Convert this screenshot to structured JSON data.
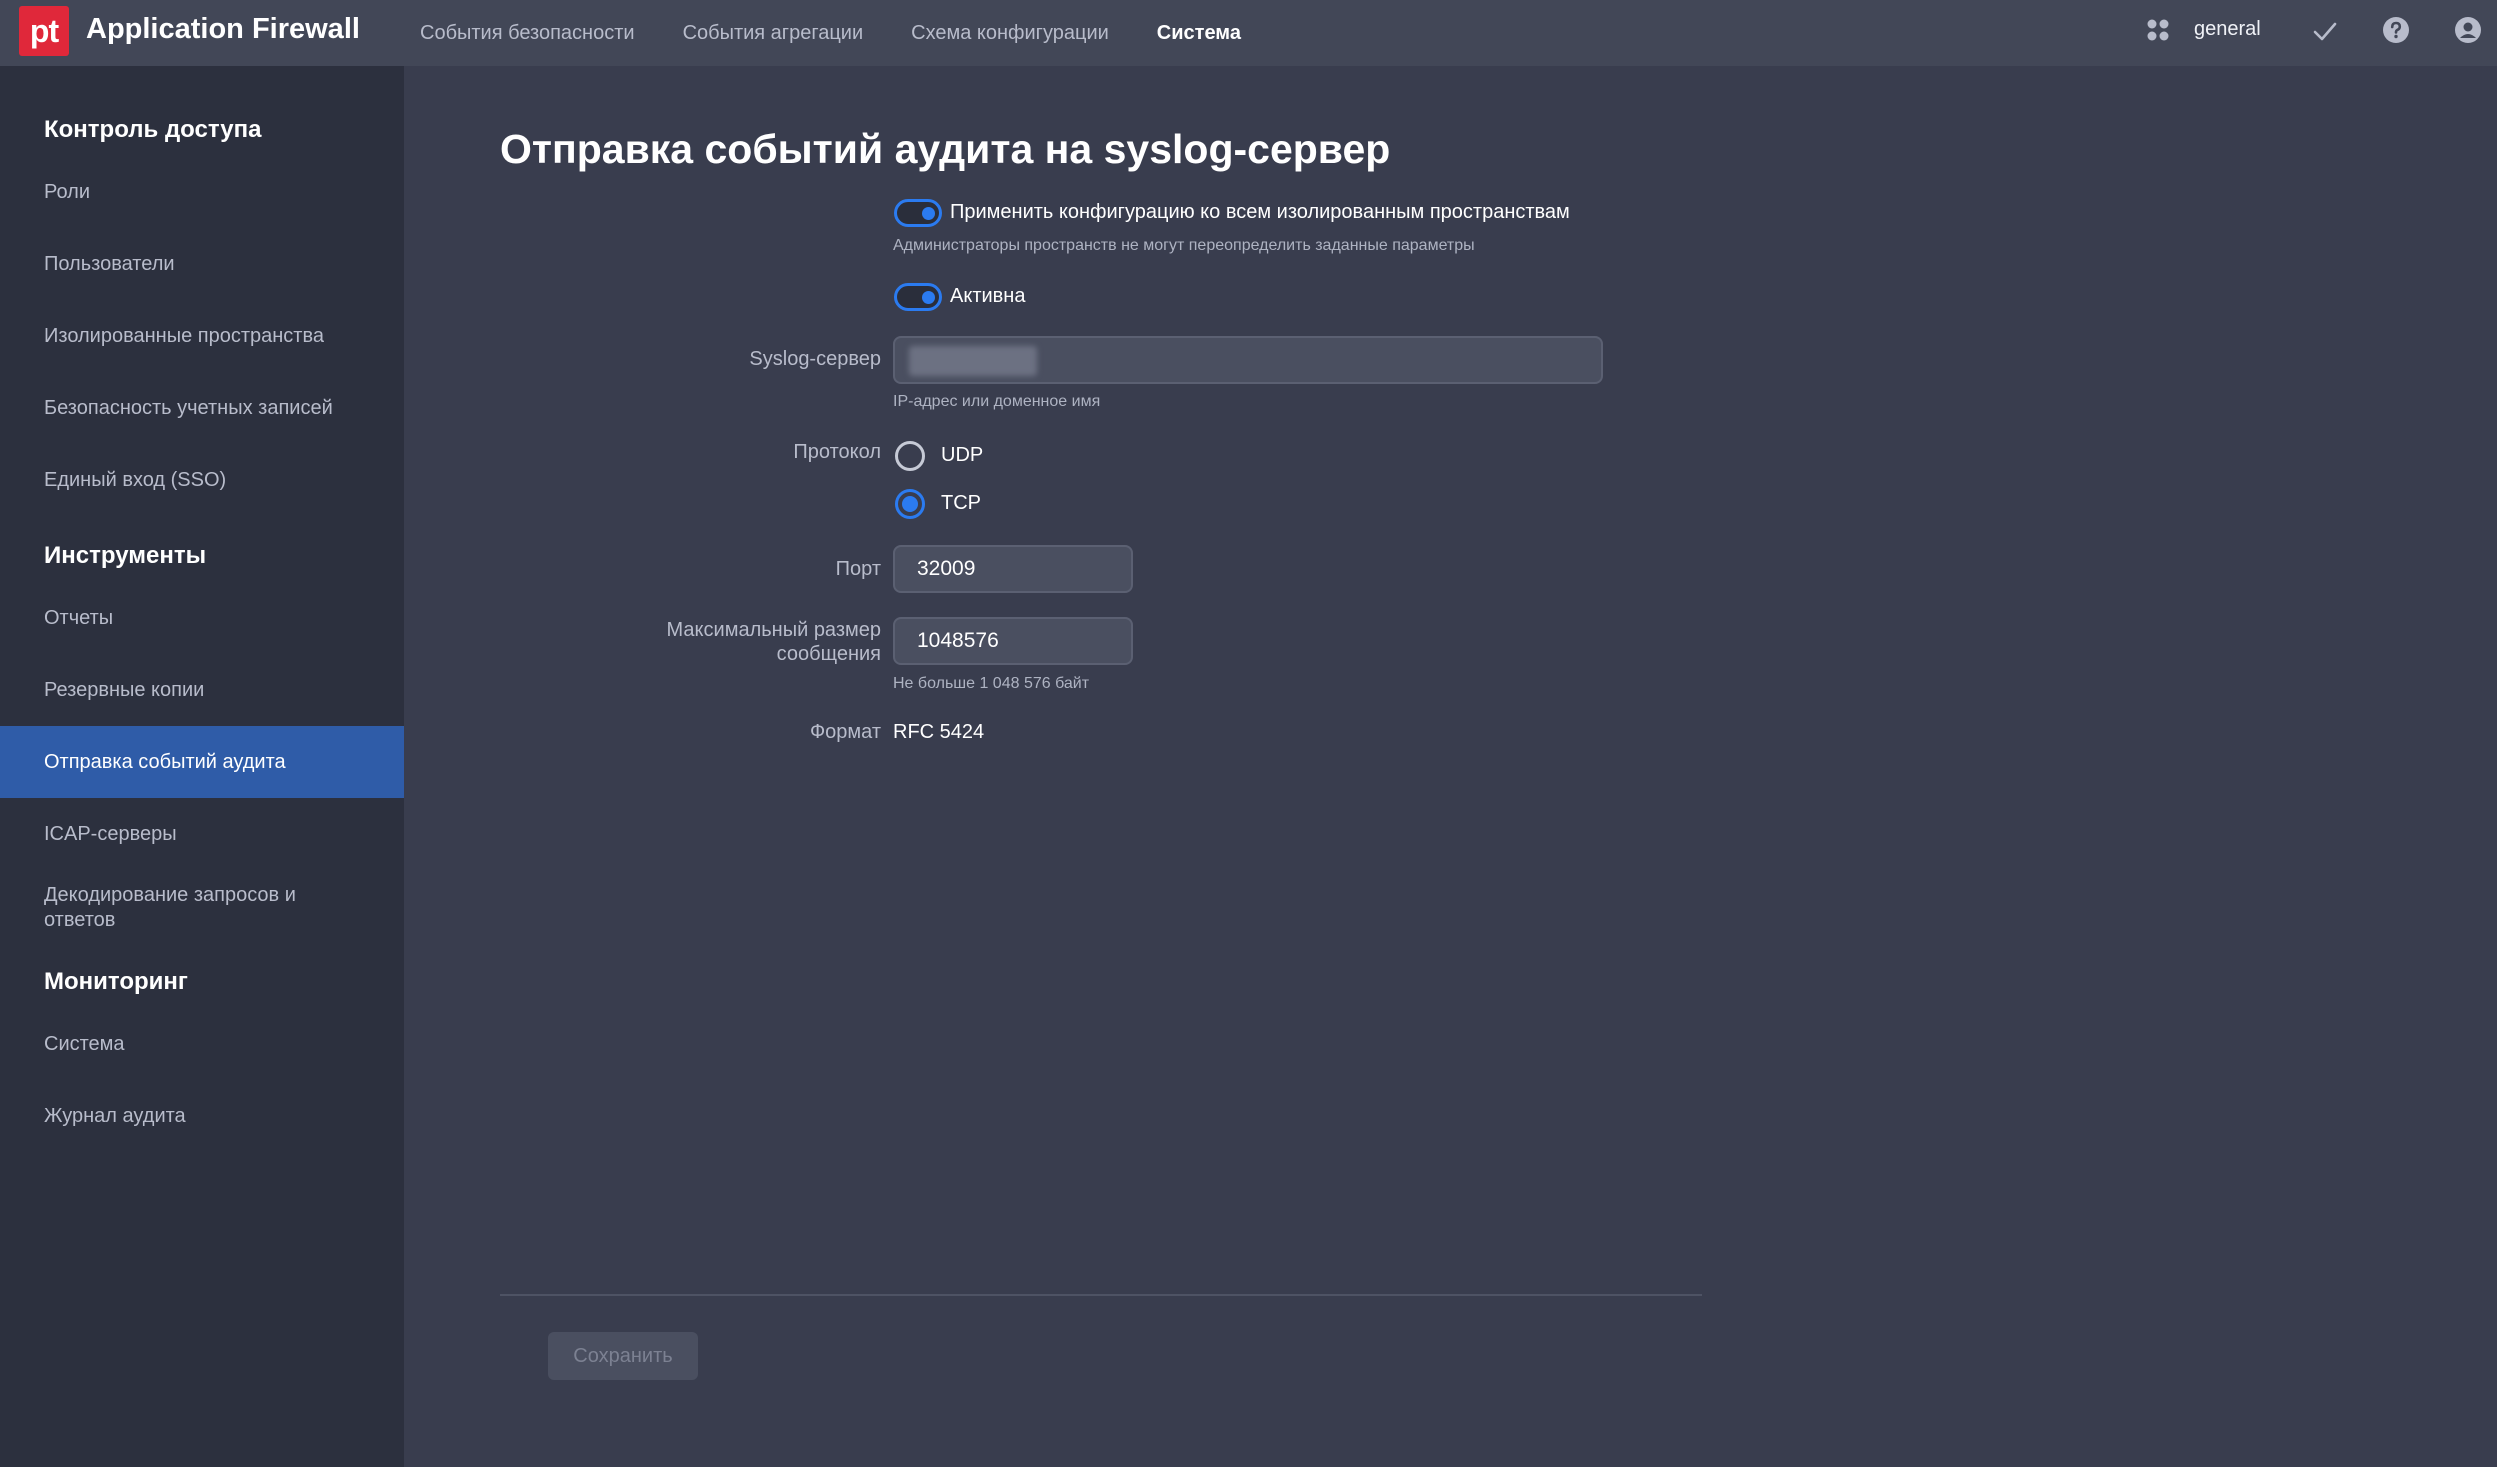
{
  "header": {
    "logo_text": "pt",
    "app_title": "Application Firewall",
    "nav": [
      {
        "label": "События безопасности"
      },
      {
        "label": "События агрегации"
      },
      {
        "label": "Схема конфигурации"
      },
      {
        "label": "Система"
      }
    ],
    "active_nav": "Система",
    "workspace": "general"
  },
  "sidebar": {
    "sections": [
      {
        "title": "Контроль доступа"
      },
      {
        "title": "Инструменты"
      },
      {
        "title": "Мониторинг"
      }
    ],
    "items": [
      {
        "label": "Роли"
      },
      {
        "label": "Пользователи"
      },
      {
        "label": "Изолированные пространства"
      },
      {
        "label": "Безопасность учетных записей"
      },
      {
        "label": "Единый вход (SSO)"
      },
      {
        "label": "Отчеты"
      },
      {
        "label": "Резервные копии"
      },
      {
        "label": "Отправка событий аудита"
      },
      {
        "label": "ICAP-серверы"
      },
      {
        "label": "Декодирование запросов и ответов"
      },
      {
        "label": "Система"
      },
      {
        "label": "Журнал аудита"
      }
    ],
    "active_item": "Отправка событий аудита"
  },
  "main": {
    "title": "Отправка событий аудита на syslog-сервер",
    "apply_all": {
      "label": "Применить конфигурацию ко всем изолированным пространствам",
      "hint": "Администраторы пространств не могут переопределить заданные параметры",
      "enabled": true
    },
    "active": {
      "label": "Активна",
      "enabled": true
    },
    "syslog_server": {
      "label": "Syslog-сервер",
      "value": "",
      "hint": "IP-адрес или доменное имя"
    },
    "protocol": {
      "label": "Протокол",
      "options": [
        {
          "label": "UDP"
        },
        {
          "label": "TCP"
        }
      ],
      "selected": "TCP"
    },
    "port": {
      "label": "Порт",
      "value": "32009"
    },
    "max_size": {
      "label_line1": "Максимальный размер",
      "label_line2": "сообщения",
      "value": "1048576",
      "hint": "Не больше 1 048 576 байт"
    },
    "format": {
      "label": "Формат",
      "value": "RFC 5424"
    },
    "save_label": "Сохранить"
  },
  "colors": {
    "accent": "#2b7bf0",
    "brand": "#e0283a",
    "active_sidebar": "#2f5ca8"
  }
}
